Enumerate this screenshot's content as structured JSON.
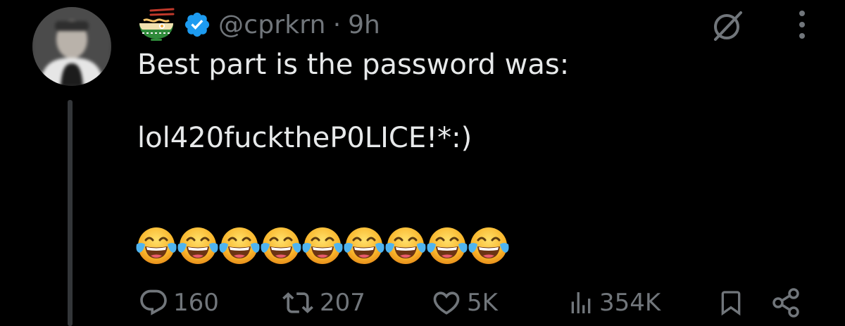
{
  "colors": {
    "background": "#000000",
    "text_primary": "#e7e9ea",
    "text_secondary": "#71767b",
    "verified_blue": "#1d9bf0",
    "thread_line": "#333639"
  },
  "tweet": {
    "handle": "@cprkrn",
    "separator": "·",
    "time": "9h",
    "text": "Best part is the password was:\n\nlol420fucktheP0LICE!*:)",
    "emojis": [
      "😂",
      "😂",
      "😂",
      "😂",
      "😂",
      "😂",
      "😂",
      "😂",
      "😂"
    ],
    "emoji_name": "face-with-tears-of-joy"
  },
  "icons": {
    "name_emoji": "ramen-bowl-icon",
    "verified": "verified-badge-icon",
    "grok": "grok-icon",
    "more": "more-options-icon",
    "reply": "reply-icon",
    "repost": "repost-icon",
    "like": "like-icon",
    "views": "views-icon",
    "bookmark": "bookmark-icon",
    "share": "share-icon"
  },
  "actions": {
    "replies": "160",
    "reposts": "207",
    "likes": "5K",
    "views": "354K"
  }
}
